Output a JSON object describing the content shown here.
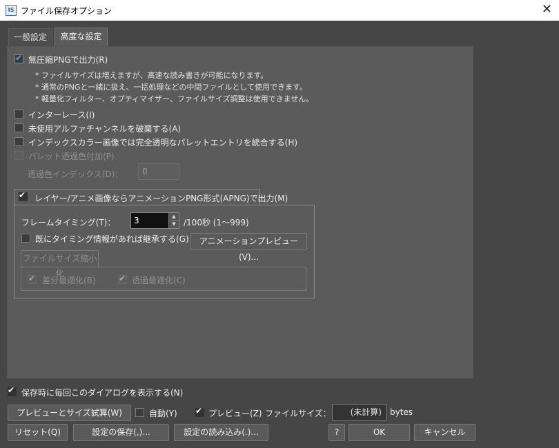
{
  "window": {
    "title": "ファイル保存オプション",
    "icon_text": "IS",
    "close_glyph": "✕"
  },
  "tabs": [
    {
      "label": "一般設定",
      "active": false
    },
    {
      "label": "高度な設定",
      "active": true
    }
  ],
  "advanced": {
    "uncompressed_png": {
      "label": "無圧縮PNGで出力(R)",
      "checked": true
    },
    "notes": [
      "* ファイルサイズは増えますが、高速な読み書きが可能になります。",
      "* 通常のPNGと一緒に扱え、一括処理などの中間ファイルとして使用できます。",
      "* 軽量化フィルター、オプティマイザー、ファイルサイズ調整は使用できません。"
    ],
    "interlace": {
      "label": "インターレース(I)",
      "checked": false
    },
    "discard_alpha": {
      "label": "未使用アルファチャンネルを破棄する(A)",
      "checked": false
    },
    "merge_palette": {
      "label": "インデックスカラー画像では完全透明なパレットエントリを統合する(H)",
      "checked": false
    },
    "palette_transparent": {
      "label": "パレット透過色付加(P)",
      "checked": false
    },
    "transparent_index": {
      "label": "透過色インデックス(D)：",
      "value": "0"
    }
  },
  "apng": {
    "label": "レイヤー/アニメ画像ならアニメーションPNG形式(APNG)で出力(M)",
    "checked": true,
    "frame_timing": {
      "label": "フレームタイミング(T)：",
      "value": "3",
      "unit": "/100秒 (1〜999)"
    },
    "inherit_timing": {
      "label": "既にタイミング情報があれば継承する(G)",
      "checked": false
    },
    "preview_button": "アニメーションプレビュー(V)...",
    "filesize_reduce": {
      "label": "ファイルサイズ縮小化",
      "diff_opt": {
        "label": "差分最適化(B)",
        "checked": true
      },
      "trans_opt": {
        "label": "透過最適化(C)",
        "checked": true
      }
    }
  },
  "footer": {
    "show_dialog": {
      "label": "保存時に毎回このダイアログを表示する(N)",
      "checked": true
    },
    "preview_size_button": "プレビューとサイズ試算(W)",
    "auto": {
      "label": "自動(Y)",
      "checked": false
    },
    "preview": {
      "label": "プレビュー(Z)",
      "checked": true
    },
    "filesize_label": "ファイルサイズ：",
    "filesize_value": "(未計算)",
    "filesize_unit": "bytes",
    "reset_button": "リセット(Q)",
    "save_settings_button": "設定の保存(,)...",
    "load_settings_button": "設定の読み込み(.)...",
    "help_button": "?",
    "ok_button": "OK",
    "cancel_button": "キャンセル"
  }
}
